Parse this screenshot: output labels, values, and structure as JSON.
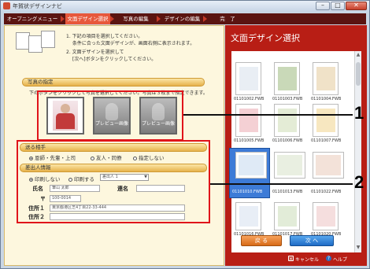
{
  "window": {
    "title": "年賀状デザインナビ",
    "min": "–",
    "max": "□",
    "close": "✕"
  },
  "steps": [
    "オープニングメニュー",
    "文面デザイン選択",
    "写真の編集",
    "デザインの編集",
    "完　了"
  ],
  "intro": [
    "1. 下記の項目を選択してください。",
    "　 条件に合った文面デザインが、画面右側に表示されます。",
    "2. 文面デザインを選択して",
    "　 [次へ]ボタンをクリックしてください。"
  ],
  "photo_section": {
    "title": "写真の指定",
    "hint": "下のボタンをクリックして写真を選択してください。写真は３枚まで指定できます。",
    "preview_label": "プレビュー画像"
  },
  "recipient": {
    "title": "送る相手",
    "options": [
      "恩師・先輩・上司",
      "友人・同僚",
      "指定しない"
    ],
    "selected": 0
  },
  "sender": {
    "title": "差出人情報",
    "print_options": [
      "印刷しない",
      "印刷する"
    ],
    "selected": 0,
    "sender_select": "差出人 1",
    "name_label": "氏名",
    "name_value": "筆山 太郎",
    "joint_label": "連名",
    "postal_label": "〒",
    "postal_value": "100-0014",
    "address1_label": "住所１",
    "address1_value": "東京都港区芝4丁目22-33-444",
    "address2_label": "住所２"
  },
  "right_panel": {
    "title": "文面デザイン選択",
    "thumbnails": [
      "01101002.FWB",
      "01101003.FWB",
      "01101004.FWB",
      "01101005.FWB",
      "01101006.FWB",
      "01101007.FWB",
      "01101010.FWB",
      "01101013.FWB",
      "01101022.FWB",
      "01101016.FWB",
      "01101017.FWB",
      "01101020.FWB"
    ],
    "back_label": "戻 る",
    "next_label": "次 へ",
    "cancel_label": "キャンセル",
    "help_label": "ヘルプ"
  },
  "callouts": [
    "1",
    "2"
  ],
  "colors": {
    "accent": "#e7583c",
    "stepbar": "#5a1411",
    "panel": "#b81e15",
    "highlight": "#e0141a"
  }
}
